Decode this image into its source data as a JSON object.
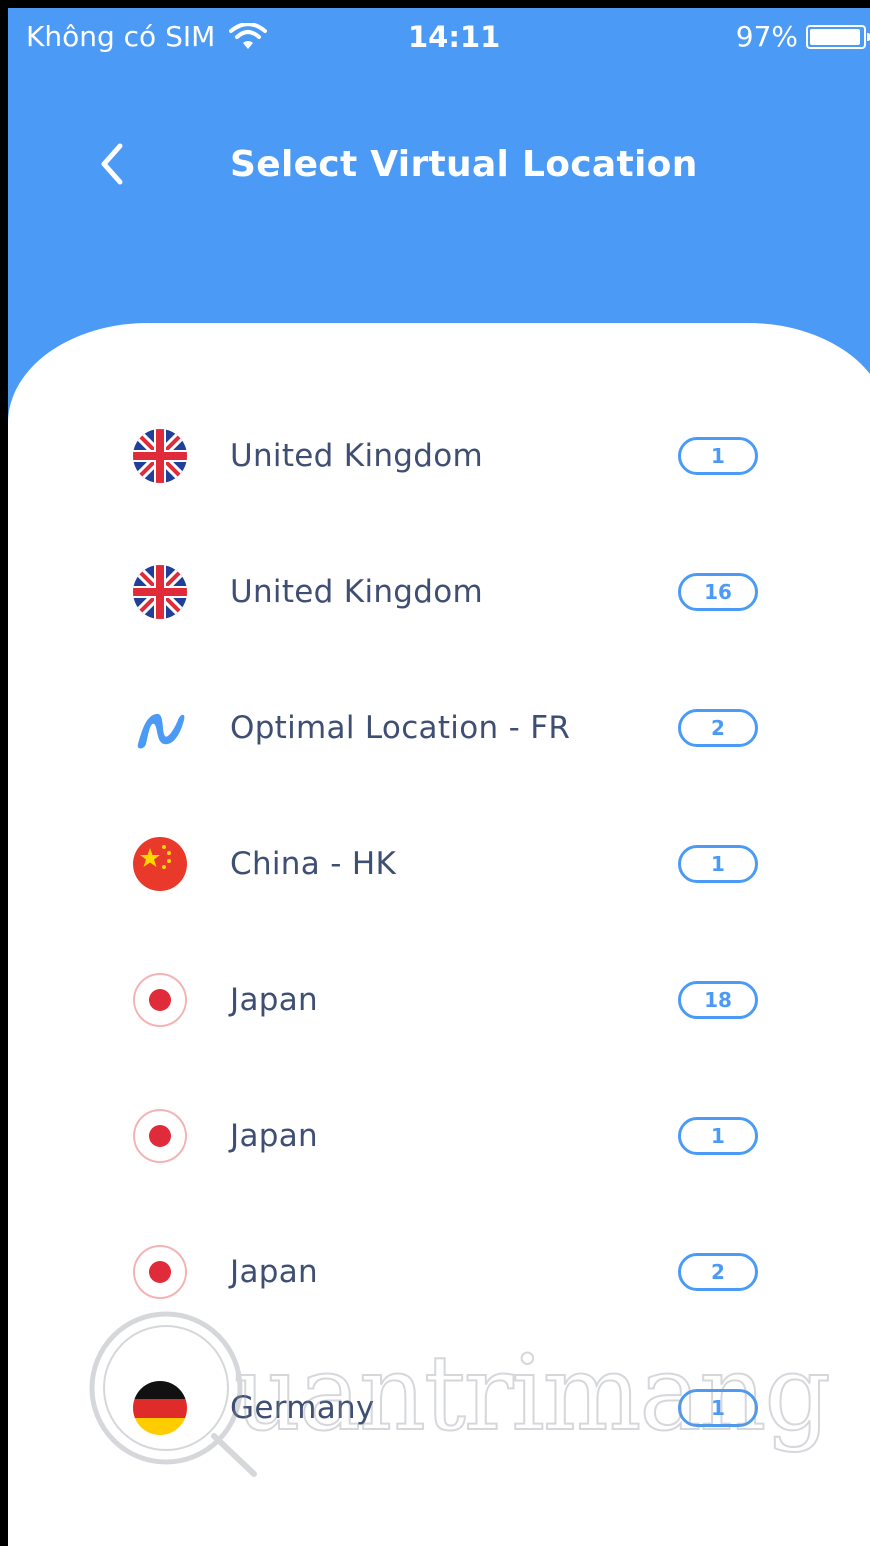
{
  "status_bar": {
    "carrier": "Không có SIM",
    "time": "14:11",
    "battery_percent": "97%",
    "battery_level": 0.97
  },
  "header": {
    "title": "Select Virtual Location",
    "back_icon": "chevron-left-icon"
  },
  "locations": [
    {
      "name": "United Kingdom",
      "count": "1",
      "flag": "uk-flag-icon"
    },
    {
      "name": "United Kingdom",
      "count": "16",
      "flag": "uk-flag-icon"
    },
    {
      "name": "Optimal Location - FR",
      "count": "2",
      "flag": "optimal-location-icon"
    },
    {
      "name": "China - HK",
      "count": "1",
      "flag": "china-flag-icon"
    },
    {
      "name": "Japan",
      "count": "18",
      "flag": "japan-flag-icon"
    },
    {
      "name": "Japan",
      "count": "1",
      "flag": "japan-flag-icon"
    },
    {
      "name": "Japan",
      "count": "2",
      "flag": "japan-flag-icon"
    },
    {
      "name": "Germany",
      "count": "1",
      "flag": "germany-flag-icon"
    }
  ],
  "watermark": {
    "text": "uantrimang",
    "logo": "quantrimang-logo"
  },
  "colors": {
    "header_blue": "#4b9bf6",
    "text_dark": "#3f4f73",
    "badge_blue": "#4b9bf6"
  }
}
